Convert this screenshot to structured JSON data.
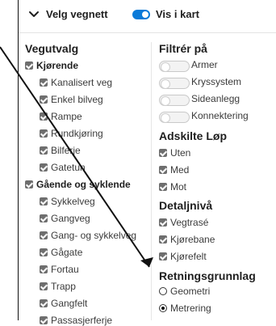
{
  "header": {
    "title": "Velg vegnett",
    "toggle_label": "Vis i kart"
  },
  "left": {
    "section_title": "Vegutvalg",
    "groups": [
      {
        "label": "Kjørende",
        "items": [
          "Kanalisert veg",
          "Enkel bilveg",
          "Rampe",
          "Rundkjøring",
          "Bilferje",
          "Gatetun"
        ]
      },
      {
        "label": "Gående og syklende",
        "items": [
          "Sykkelveg",
          "Gangveg",
          "Gang- og sykkelveg",
          "Gågate",
          "Fortau",
          "Trapp",
          "Gangfelt",
          "Passasjerferje"
        ]
      }
    ]
  },
  "right": {
    "filter": {
      "title": "Filtrér på",
      "items": [
        "Armer",
        "Kryssystem",
        "Sideanlegg",
        "Konnektering"
      ]
    },
    "adskilte": {
      "title": "Adskilte Løp",
      "items": [
        "Uten",
        "Med",
        "Mot"
      ]
    },
    "detalj": {
      "title": "Detaljnivå",
      "items": [
        "Vegtrasé",
        "Kjørebane",
        "Kjørefelt"
      ]
    },
    "retning": {
      "title": "Retningsgrunnlag",
      "options": [
        "Geometri",
        "Metrering"
      ],
      "selected": "Metrering"
    }
  },
  "colors": {
    "toggle_on": "#0a7ad8",
    "checkbox": "#6e6e6e"
  }
}
